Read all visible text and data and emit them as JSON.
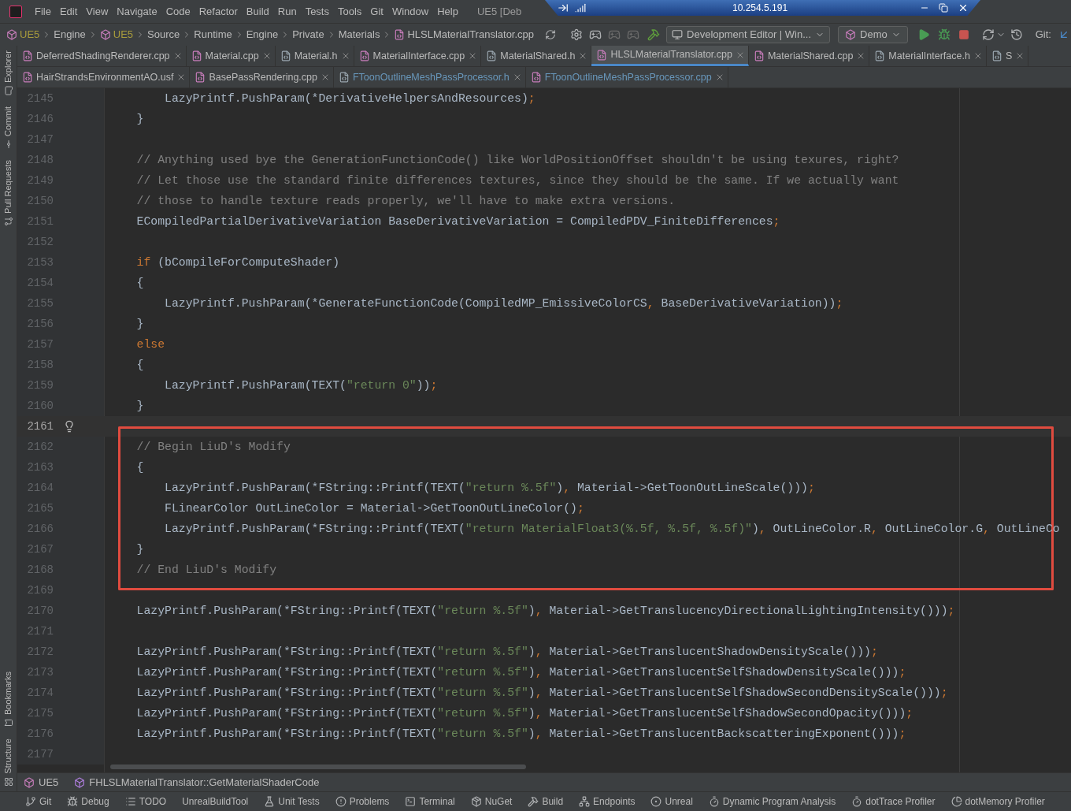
{
  "title_bar": {
    "menu": [
      "File",
      "Edit",
      "View",
      "Navigate",
      "Code",
      "Refactor",
      "Build",
      "Run",
      "Tests",
      "Tools",
      "Git",
      "Window",
      "Help"
    ],
    "project_title": "UE5 [Deb",
    "remote": {
      "address": "10.254.5.191"
    }
  },
  "nav_bar": {
    "breadcrumbs": [
      {
        "label": "UE5",
        "kind": "project"
      },
      {
        "label": "Engine",
        "kind": "folder"
      },
      {
        "label": "UE5",
        "kind": "project"
      },
      {
        "label": "Source",
        "kind": "folder"
      },
      {
        "label": "Runtime",
        "kind": "folder"
      },
      {
        "label": "Engine",
        "kind": "folder"
      },
      {
        "label": "Private",
        "kind": "folder"
      },
      {
        "label": "Materials",
        "kind": "folder"
      },
      {
        "label": "HLSLMaterialTranslator.cpp",
        "kind": "file"
      }
    ],
    "config": "Development Editor | Win...",
    "run_target": "Demo",
    "git_label": "Git:"
  },
  "side_stripe": {
    "top": [
      {
        "label": "Explorer",
        "kind": "folder"
      },
      {
        "label": "Commit",
        "kind": "commit"
      },
      {
        "label": "Pull Requests",
        "kind": "pull"
      }
    ],
    "bottom": [
      {
        "label": "Bookmarks",
        "kind": "bookmark"
      },
      {
        "label": "Structure",
        "kind": "structure"
      }
    ]
  },
  "tab_rows": [
    [
      {
        "label": "DeferredShadingRenderer.cpp",
        "kind": "cpp",
        "selected": false,
        "modified": false
      },
      {
        "label": "Material.cpp",
        "kind": "cpp",
        "selected": false,
        "modified": false
      },
      {
        "label": "Material.h",
        "kind": "h",
        "selected": false,
        "modified": false
      },
      {
        "label": "MaterialInterface.cpp",
        "kind": "cpp",
        "selected": false,
        "modified": false
      },
      {
        "label": "MaterialShared.h",
        "kind": "h",
        "selected": false,
        "modified": false
      },
      {
        "label": "HLSLMaterialTranslator.cpp",
        "kind": "cpp",
        "selected": true,
        "modified": false
      },
      {
        "label": "MaterialShared.cpp",
        "kind": "cpp",
        "selected": false,
        "modified": false
      },
      {
        "label": "MaterialInterface.h",
        "kind": "h",
        "selected": false,
        "modified": false
      },
      {
        "label": "S",
        "kind": "h",
        "selected": false,
        "modified": false
      }
    ],
    [
      {
        "label": "HairStrandsEnvironmentAO.usf",
        "kind": "cpp",
        "selected": false,
        "modified": false
      },
      {
        "label": "BasePassRendering.cpp",
        "kind": "cpp",
        "selected": false,
        "modified": false
      },
      {
        "label": "FToonOutlineMeshPassProcessor.h",
        "kind": "h",
        "selected": false,
        "modified": true
      },
      {
        "label": "FToonOutlineMeshPassProcessor.cpp",
        "kind": "cpp",
        "selected": false,
        "modified": true
      }
    ]
  ],
  "editor": {
    "lines": [
      {
        "number": "2145",
        "current": false,
        "boxed": false,
        "segments": [
          {
            "kind": "code",
            "text": "        LazyPrintf.PushParam(*DerivativeHelpersAndResources)"
          },
          {
            "kind": "punct",
            "text": ";"
          }
        ]
      },
      {
        "number": "2146",
        "current": false,
        "boxed": false,
        "segments": [
          {
            "kind": "code",
            "text": "    }"
          }
        ]
      },
      {
        "number": "2147",
        "current": false,
        "boxed": false
      },
      {
        "number": "2148",
        "current": false,
        "boxed": false,
        "segments": [
          {
            "kind": "comment",
            "text": "    // Anything used bye the GenerationFunctionCode() like WorldPositionOffset shouldn't be using texures, right?"
          }
        ]
      },
      {
        "number": "2149",
        "current": false,
        "boxed": false,
        "segments": [
          {
            "kind": "comment",
            "text": "    // Let those use the standard finite differences textures, since they should be the same. If we actually want"
          }
        ]
      },
      {
        "number": "2150",
        "current": false,
        "boxed": false,
        "segments": [
          {
            "kind": "comment",
            "text": "    // those to handle texture reads properly, we'll have to make extra versions."
          }
        ]
      },
      {
        "number": "2151",
        "current": false,
        "boxed": false,
        "segments": [
          {
            "kind": "code",
            "text": "    ECompiledPartialDerivativeVariation BaseDerivativeVariation = CompiledPDV_FiniteDifferences"
          },
          {
            "kind": "punct",
            "text": ";"
          }
        ]
      },
      {
        "number": "2152",
        "current": false,
        "boxed": false
      },
      {
        "number": "2153",
        "current": false,
        "boxed": false,
        "segments": [
          {
            "kind": "keyword",
            "text": "    if"
          },
          {
            "kind": "code",
            "text": " (bCompileForComputeShader)"
          }
        ]
      },
      {
        "number": "2154",
        "current": false,
        "boxed": false,
        "segments": [
          {
            "kind": "code",
            "text": "    {"
          }
        ]
      },
      {
        "number": "2155",
        "current": false,
        "boxed": false,
        "segments": [
          {
            "kind": "code",
            "text": "        LazyPrintf.PushParam(*GenerateFunctionCode(CompiledMP_EmissiveColorCS"
          },
          {
            "kind": "punct",
            "text": ","
          },
          {
            "kind": "code",
            "text": " BaseDerivativeVariation))"
          },
          {
            "kind": "punct",
            "text": ";"
          }
        ]
      },
      {
        "number": "2156",
        "current": false,
        "boxed": false,
        "segments": [
          {
            "kind": "code",
            "text": "    }"
          }
        ]
      },
      {
        "number": "2157",
        "current": false,
        "boxed": false,
        "segments": [
          {
            "kind": "keyword",
            "text": "    else"
          }
        ]
      },
      {
        "number": "2158",
        "current": false,
        "boxed": false,
        "segments": [
          {
            "kind": "code",
            "text": "    {"
          }
        ]
      },
      {
        "number": "2159",
        "current": false,
        "boxed": false,
        "segments": [
          {
            "kind": "code",
            "text": "        LazyPrintf.PushParam(TEXT("
          },
          {
            "kind": "string",
            "text": "\"return 0\""
          },
          {
            "kind": "code",
            "text": "))"
          },
          {
            "kind": "punct",
            "text": ";"
          }
        ]
      },
      {
        "number": "2160",
        "current": false,
        "boxed": false,
        "segments": [
          {
            "kind": "code",
            "text": "    }"
          }
        ]
      },
      {
        "number": "2161",
        "current": true,
        "boxed": false
      },
      {
        "number": "2162",
        "current": false,
        "boxed": true,
        "segments": [
          {
            "kind": "comment",
            "text": "    // Begin LiuD's Modify"
          }
        ]
      },
      {
        "number": "2163",
        "current": false,
        "boxed": true,
        "segments": [
          {
            "kind": "code",
            "text": "    {"
          }
        ]
      },
      {
        "number": "2164",
        "current": false,
        "boxed": true,
        "segments": [
          {
            "kind": "code",
            "text": "        LazyPrintf.PushParam(*FString::Printf(TEXT("
          },
          {
            "kind": "string",
            "text": "\"return %.5f\""
          },
          {
            "kind": "code",
            "text": ")"
          },
          {
            "kind": "punct",
            "text": ","
          },
          {
            "kind": "code",
            "text": " Material->GetToonOutLineScale()))"
          },
          {
            "kind": "punct",
            "text": ";"
          }
        ]
      },
      {
        "number": "2165",
        "current": false,
        "boxed": true,
        "segments": [
          {
            "kind": "code",
            "text": "        FLinearColor OutLineColor = Material->GetToonOutLineColor()"
          },
          {
            "kind": "punct",
            "text": ";"
          }
        ]
      },
      {
        "number": "2166",
        "current": false,
        "boxed": true,
        "segments": [
          {
            "kind": "code",
            "text": "        LazyPrintf.PushParam(*FString::Printf(TEXT("
          },
          {
            "kind": "string",
            "text": "\"return MaterialFloat3(%.5f, %.5f, %.5f)\""
          },
          {
            "kind": "code",
            "text": ")"
          },
          {
            "kind": "punct",
            "text": ","
          },
          {
            "kind": "code",
            "text": " OutLineColor.R"
          },
          {
            "kind": "punct",
            "text": ","
          },
          {
            "kind": "code",
            "text": " OutLineColor.G"
          },
          {
            "kind": "punct",
            "text": ","
          },
          {
            "kind": "code",
            "text": " OutLineCo"
          }
        ]
      },
      {
        "number": "2167",
        "current": false,
        "boxed": true,
        "segments": [
          {
            "kind": "code",
            "text": "    }"
          }
        ]
      },
      {
        "number": "2168",
        "current": false,
        "boxed": true,
        "segments": [
          {
            "kind": "comment",
            "text": "    // End LiuD's Modify"
          }
        ]
      },
      {
        "number": "2169",
        "current": false,
        "boxed": false
      },
      {
        "number": "2170",
        "current": false,
        "boxed": false,
        "segments": [
          {
            "kind": "code",
            "text": "    LazyPrintf.PushParam(*FString::Printf(TEXT("
          },
          {
            "kind": "string",
            "text": "\"return %.5f\""
          },
          {
            "kind": "code",
            "text": ")"
          },
          {
            "kind": "punct",
            "text": ","
          },
          {
            "kind": "code",
            "text": " Material->GetTranslucencyDirectionalLightingIntensity()))"
          },
          {
            "kind": "punct",
            "text": ";"
          }
        ]
      },
      {
        "number": "2171",
        "current": false,
        "boxed": false
      },
      {
        "number": "2172",
        "current": false,
        "boxed": false,
        "segments": [
          {
            "kind": "code",
            "text": "    LazyPrintf.PushParam(*FString::Printf(TEXT("
          },
          {
            "kind": "string",
            "text": "\"return %.5f\""
          },
          {
            "kind": "code",
            "text": ")"
          },
          {
            "kind": "punct",
            "text": ","
          },
          {
            "kind": "code",
            "text": " Material->GetTranslucentShadowDensityScale()))"
          },
          {
            "kind": "punct",
            "text": ";"
          }
        ]
      },
      {
        "number": "2173",
        "current": false,
        "boxed": false,
        "segments": [
          {
            "kind": "code",
            "text": "    LazyPrintf.PushParam(*FString::Printf(TEXT("
          },
          {
            "kind": "string",
            "text": "\"return %.5f\""
          },
          {
            "kind": "code",
            "text": ")"
          },
          {
            "kind": "punct",
            "text": ","
          },
          {
            "kind": "code",
            "text": " Material->GetTranslucentSelfShadowDensityScale()))"
          },
          {
            "kind": "punct",
            "text": ";"
          }
        ]
      },
      {
        "number": "2174",
        "current": false,
        "boxed": false,
        "segments": [
          {
            "kind": "code",
            "text": "    LazyPrintf.PushParam(*FString::Printf(TEXT("
          },
          {
            "kind": "string",
            "text": "\"return %.5f\""
          },
          {
            "kind": "code",
            "text": ")"
          },
          {
            "kind": "punct",
            "text": ","
          },
          {
            "kind": "code",
            "text": " Material->GetTranslucentSelfShadowSecondDensityScale()))"
          },
          {
            "kind": "punct",
            "text": ";"
          }
        ]
      },
      {
        "number": "2175",
        "current": false,
        "boxed": false,
        "segments": [
          {
            "kind": "code",
            "text": "    LazyPrintf.PushParam(*FString::Printf(TEXT("
          },
          {
            "kind": "string",
            "text": "\"return %.5f\""
          },
          {
            "kind": "code",
            "text": ")"
          },
          {
            "kind": "punct",
            "text": ","
          },
          {
            "kind": "code",
            "text": " Material->GetTranslucentSelfShadowSecondOpacity()))"
          },
          {
            "kind": "punct",
            "text": ";"
          }
        ]
      },
      {
        "number": "2176",
        "current": false,
        "boxed": false,
        "segments": [
          {
            "kind": "code",
            "text": "    LazyPrintf.PushParam(*FString::Printf(TEXT("
          },
          {
            "kind": "string",
            "text": "\"return %.5f\""
          },
          {
            "kind": "code",
            "text": ")"
          },
          {
            "kind": "punct",
            "text": ","
          },
          {
            "kind": "code",
            "text": " Material->GetTranslucentBackscatteringExponent()))"
          },
          {
            "kind": "punct",
            "text": ";"
          }
        ]
      },
      {
        "number": "2177",
        "current": false,
        "boxed": false
      }
    ]
  },
  "breadcrumb_bar": [
    {
      "label": "UE5",
      "kind": "project"
    },
    {
      "label": "FHLSLMaterialTranslator::GetMaterialShaderCode",
      "kind": "method"
    }
  ],
  "tool_windows": [
    {
      "label": "Git",
      "kind": "git"
    },
    {
      "label": "Debug",
      "kind": "debug"
    },
    {
      "label": "TODO",
      "kind": "todo"
    },
    {
      "label": "UnrealBuildTool",
      "kind": "plain"
    },
    {
      "label": "Unit Tests",
      "kind": "tests"
    },
    {
      "label": "Problems",
      "kind": "problems"
    },
    {
      "label": "Terminal",
      "kind": "terminal"
    },
    {
      "label": "NuGet",
      "kind": "nuget"
    },
    {
      "label": "Build",
      "kind": "build"
    },
    {
      "label": "Endpoints",
      "kind": "endpoints"
    },
    {
      "label": "Unreal",
      "kind": "unreal"
    },
    {
      "label": "Dynamic Program Analysis",
      "kind": "dpa"
    },
    {
      "label": "dotTrace Profiler",
      "kind": "trace"
    },
    {
      "label": "dotMemory Profiler",
      "kind": "memory"
    }
  ]
}
